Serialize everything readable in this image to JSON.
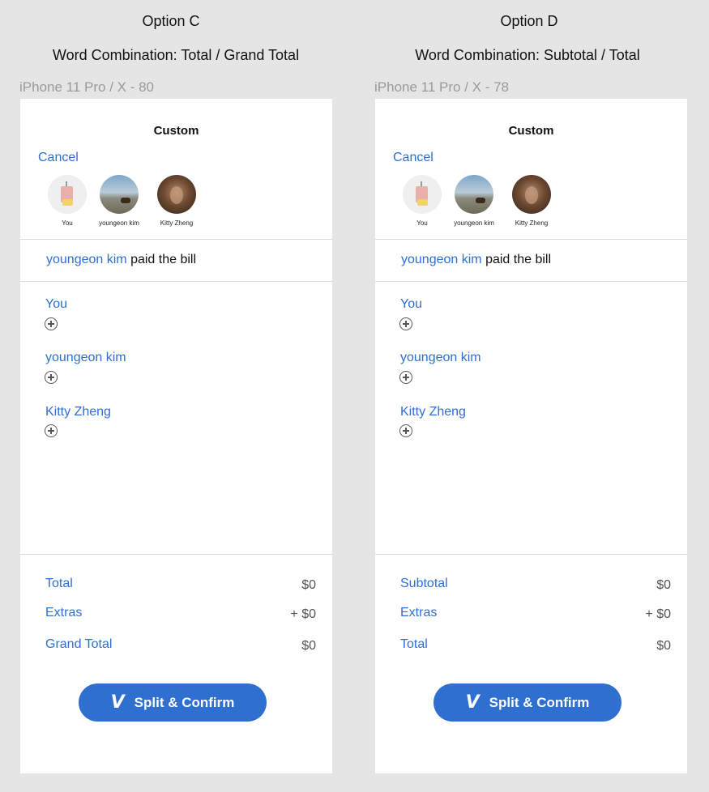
{
  "options": [
    {
      "option_title": "Option C",
      "combination_title": "Word Combination: Total / Grand Total",
      "frame_label": "iPhone 11 Pro / X - 80",
      "screen_title": "Custom",
      "cancel_label": "Cancel",
      "avatars": [
        {
          "name": "You",
          "icon": "avatar-you-icon"
        },
        {
          "name": "youngeon kim",
          "icon": "avatar-youngeon-icon"
        },
        {
          "name": "Kitty Zheng",
          "icon": "avatar-kitty-icon"
        }
      ],
      "payer_name": "youngeon kim",
      "payer_suffix": " paid the bill",
      "people": [
        "You",
        "youngeon kim",
        "Kitty Zheng"
      ],
      "summary": [
        {
          "label": "Total",
          "value": "$0"
        },
        {
          "label": "Extras",
          "value": "+ $0"
        },
        {
          "label": "Grand Total",
          "value": "$0"
        }
      ],
      "button_icon": "V",
      "button_label": "Split & Confirm"
    },
    {
      "option_title": "Option D",
      "combination_title": "Word Combination: Subtotal / Total",
      "frame_label": "iPhone 11 Pro / X - 78",
      "screen_title": "Custom",
      "cancel_label": "Cancel",
      "avatars": [
        {
          "name": "You",
          "icon": "avatar-you-icon"
        },
        {
          "name": "youngeon kim",
          "icon": "avatar-youngeon-icon"
        },
        {
          "name": "Kitty Zheng",
          "icon": "avatar-kitty-icon"
        }
      ],
      "payer_name": "youngeon kim",
      "payer_suffix": " paid the bill",
      "people": [
        "You",
        "youngeon kim",
        "Kitty Zheng"
      ],
      "summary": [
        {
          "label": "Subtotal",
          "value": "$0"
        },
        {
          "label": "Extras",
          "value": "+ $0"
        },
        {
          "label": "Total",
          "value": "$0"
        }
      ],
      "button_icon": "V",
      "button_label": "Split & Confirm"
    }
  ],
  "colors": {
    "accent": "#2f6fd0",
    "background": "#e5e5e5",
    "screen": "#ffffff"
  }
}
